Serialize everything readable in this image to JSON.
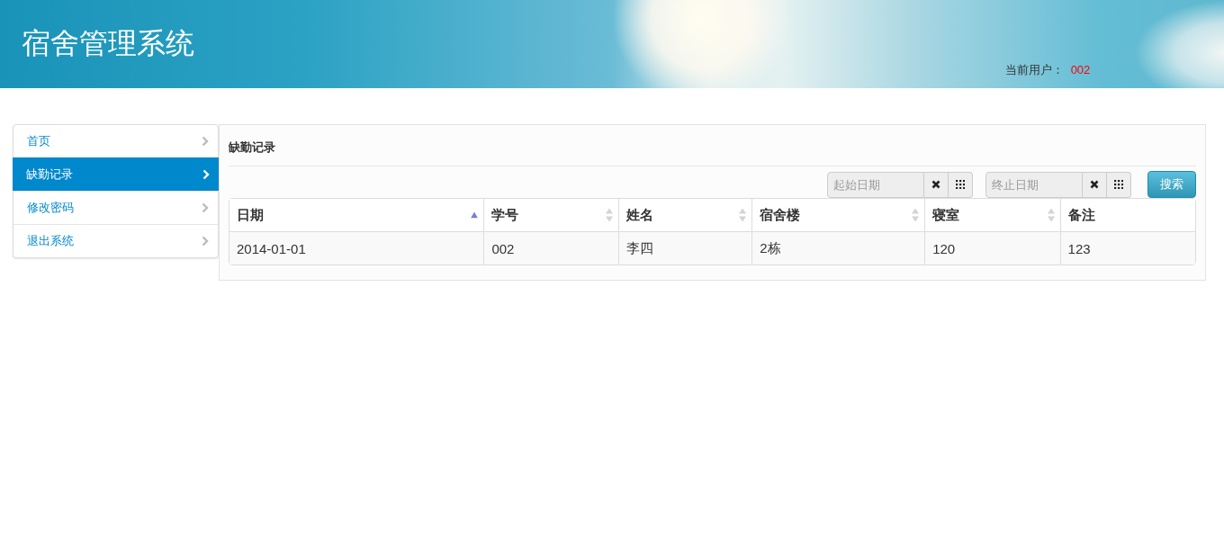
{
  "header": {
    "title": "宿舍管理系统",
    "user_label": "当前用户：",
    "user_value": "002"
  },
  "sidebar": {
    "items": [
      {
        "label": "首页",
        "selected": false
      },
      {
        "label": "缺勤记录",
        "selected": true
      },
      {
        "label": "修改密码",
        "selected": false
      },
      {
        "label": "退出系统",
        "selected": false
      }
    ]
  },
  "panel": {
    "title": "缺勤记录",
    "filters": [
      {
        "placeholder": "起始日期"
      },
      {
        "placeholder": "终止日期"
      }
    ],
    "search_button": "搜索",
    "table": {
      "columns": [
        {
          "label": "日期",
          "sortable": true,
          "sorted": true
        },
        {
          "label": "学号",
          "sortable": true,
          "sorted": false
        },
        {
          "label": "姓名",
          "sortable": true,
          "sorted": false
        },
        {
          "label": "宿舍楼",
          "sortable": true,
          "sorted": false
        },
        {
          "label": "寝室",
          "sortable": true,
          "sorted": false
        },
        {
          "label": "备注",
          "sortable": false,
          "sorted": false
        }
      ],
      "rows": [
        [
          "2014-01-01",
          "002",
          "李四",
          "2栋",
          "120",
          "123"
        ]
      ]
    }
  }
}
